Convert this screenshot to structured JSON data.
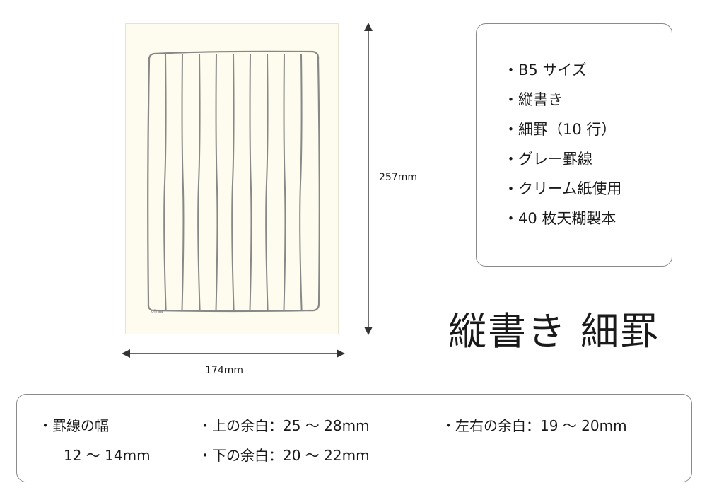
{
  "diagram": {
    "width_label": "174mm",
    "height_label": "257mm",
    "line_color": "#888888",
    "paper_color": "#fdfcee",
    "ruled_rows": 10,
    "sheet_mark": "ohaa"
  },
  "specs": {
    "items": [
      "B5 サイズ",
      "縦書き",
      "細罫（10 行）",
      "グレー罫線",
      "クリーム紙使用",
      "40 枚天糊製本"
    ]
  },
  "product_title": "縦書き 細罫",
  "margins": {
    "line_width_label": "罫線の幅",
    "line_width_value": "12 ～ 14mm",
    "top_margin": "上の余白：25 ～ 28mm",
    "bottom_margin": "下の余白：20 ～ 22mm",
    "side_margin": "左右の余白：19 ～ 20mm"
  }
}
